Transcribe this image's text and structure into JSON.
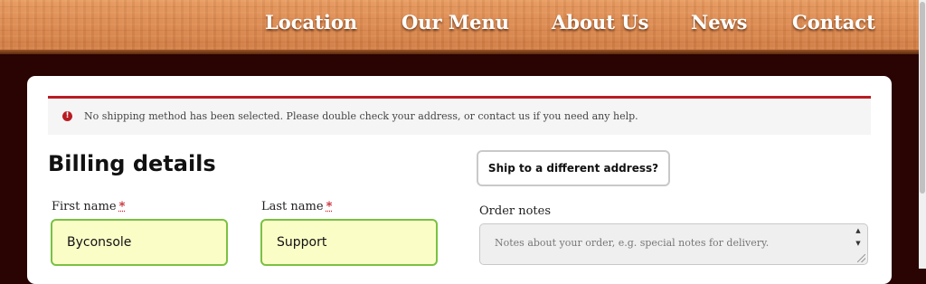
{
  "nav": {
    "items": [
      {
        "label": "Location"
      },
      {
        "label": "Our Menu"
      },
      {
        "label": "About Us"
      },
      {
        "label": "News"
      },
      {
        "label": "Contact"
      }
    ]
  },
  "notice": {
    "icon": "exclamation-circle-icon",
    "color": "#b81c23",
    "text": "No shipping method has been selected. Please double check your address, or contact us if you need any help."
  },
  "billing": {
    "title": "Billing details",
    "first_name": {
      "label": "First name",
      "required_mark": "*",
      "value": "Byconsole"
    },
    "last_name": {
      "label": "Last name",
      "required_mark": "*",
      "value": "Support"
    }
  },
  "shipping": {
    "toggle_label": "Ship to a different address?"
  },
  "order_notes": {
    "label": "Order notes",
    "placeholder": "Notes about your order, e.g. special notes for delivery."
  },
  "colors": {
    "background": "#2a0303",
    "input_valid_border": "#7ac142",
    "input_fill": "#fbfdc7",
    "error_accent": "#b81c23"
  }
}
